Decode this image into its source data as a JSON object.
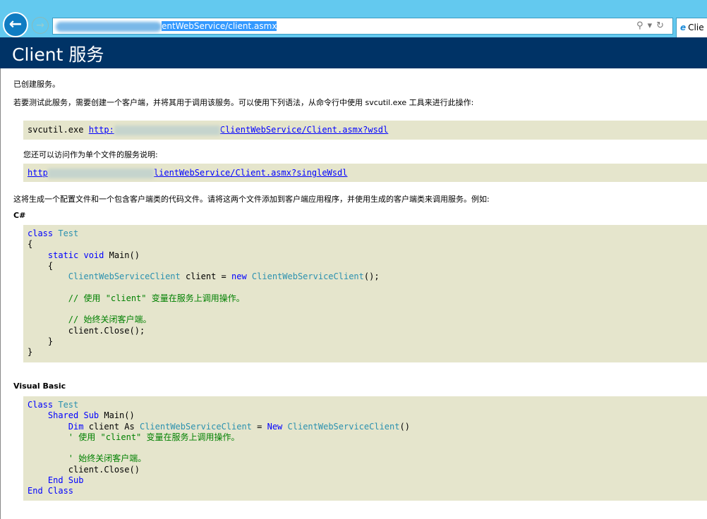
{
  "browser": {
    "url_visible": "entWebService/client.asmx",
    "tab_title": "Clie",
    "back_icon": "arrow-left-icon",
    "forward_icon": "arrow-right-icon"
  },
  "header": {
    "title": "Client 服务"
  },
  "intro": {
    "created": "已创建服务。",
    "test_instructions": "若要测试此服务，需要创建一个客户端，并将其用于调用该服务。可以使用下列语法，从命令行中使用 svcutil.exe 工具来进行此操作:",
    "svcutil_cmd": "svcutil.exe",
    "wsdl_link": "http:",
    "wsdl_link_tail": "ClientWebService/Client.asmx?wsdl",
    "single_file_text": "您还可以访问作为单个文件的服务说明:",
    "single_link": "http",
    "single_link_tail": "lientWebService/Client.asmx?singleWsdl",
    "generate_text": "这将生成一个配置文件和一个包含客户端类的代码文件。请将这两个文件添加到客户端应用程序，并使用生成的客户端类来调用服务。例如:"
  },
  "csharp": {
    "heading": "C#"
  },
  "vb": {
    "heading": "Visual Basic"
  },
  "colors": {
    "header_bg": "#003366",
    "code_bg": "#e5e5cc",
    "keyword": "#0000ff",
    "type": "#2b91af",
    "comment": "#008000"
  }
}
